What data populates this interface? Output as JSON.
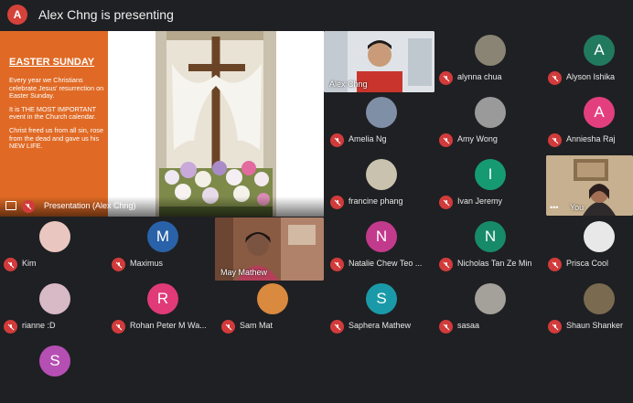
{
  "header": {
    "presenter_initial": "A",
    "presenting_text": "Alex Chng is presenting"
  },
  "presentation": {
    "slide_title": "EASTER SUNDAY",
    "paragraphs": [
      "Every year we Christians celebrate Jesus' resurrection on Easter Sunday.",
      "It is THE MOST IMPORTANT event in the Church calendar.",
      "Christ freed us from all sin, rose from the dead and gave us his NEW LIFE."
    ],
    "label": "Presentation (Alex Chng)"
  },
  "videos": {
    "alex": "Alex Chng",
    "you": "You",
    "may": "May Mathew"
  },
  "participants": [
    {
      "name": "alynna chua",
      "initial": "",
      "color": "#8a8474"
    },
    {
      "name": "Alyson Ishika",
      "initial": "A",
      "color": "#227a5e"
    },
    {
      "name": "Amelia Ng",
      "initial": "",
      "color": "#7f8fa6"
    },
    {
      "name": "Amy Wong",
      "initial": "",
      "color": "#9a9a9a"
    },
    {
      "name": "Anniesha Raj",
      "initial": "A",
      "color": "#e33f7f"
    },
    {
      "name": "francine phang",
      "initial": "",
      "color": "#c9c2ae"
    },
    {
      "name": "Ivan Jeremy",
      "initial": "I",
      "color": "#169a72"
    },
    {
      "name": "Kim",
      "initial": "",
      "color": "#e9c7c0"
    },
    {
      "name": "Maximus",
      "initial": "M",
      "color": "#2962a8"
    },
    {
      "name": "Natalie Chew Teo ...",
      "initial": "N",
      "color": "#c23a8c"
    },
    {
      "name": "Nicholas Tan Ze Min",
      "initial": "N",
      "color": "#178a6a"
    },
    {
      "name": "Prisca Cool",
      "initial": "",
      "color": "#e8e8e8"
    },
    {
      "name": "rianne :D",
      "initial": "",
      "color": "#d8b9c6"
    },
    {
      "name": "Rohan Peter M Wa...",
      "initial": "R",
      "color": "#e03a78"
    },
    {
      "name": "Sam Mat",
      "initial": "",
      "color": "#d98a3f"
    },
    {
      "name": "Saphera Mathew",
      "initial": "S",
      "color": "#1a9aa8"
    },
    {
      "name": "sasaa",
      "initial": "",
      "color": "#a4a09a"
    },
    {
      "name": "Shaun Shanker",
      "initial": "",
      "color": "#7a6a50"
    },
    {
      "name": "",
      "initial": "S",
      "color": "#b54fb3"
    }
  ]
}
